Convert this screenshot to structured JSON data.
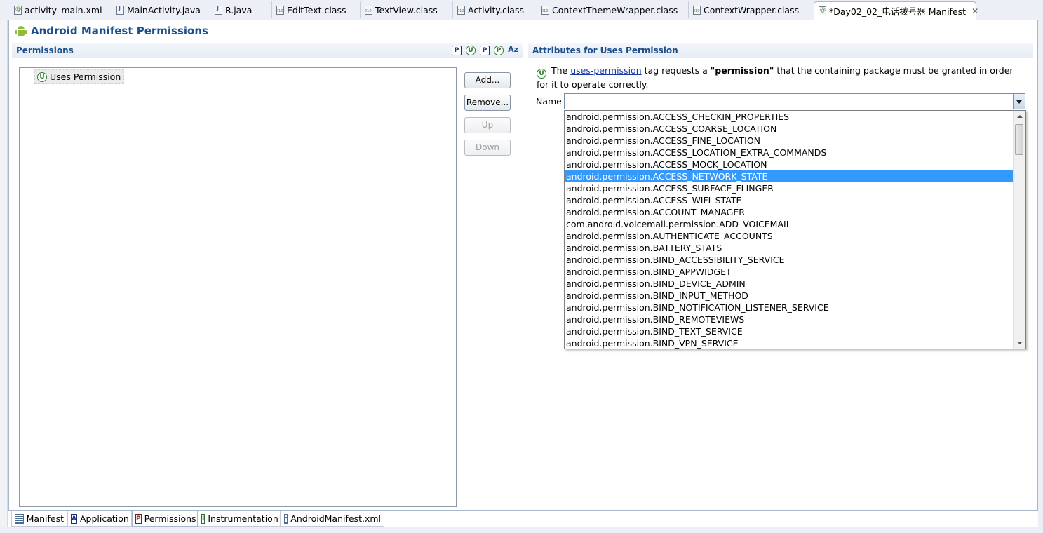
{
  "editor_tabs": [
    {
      "label": "activity_main.xml",
      "icon": "xml-file-icon"
    },
    {
      "label": "MainActivity.java",
      "icon": "java-file-icon"
    },
    {
      "label": "R.java",
      "icon": "java-file-icon"
    },
    {
      "label": "EditText.class",
      "icon": "class-file-icon"
    },
    {
      "label": "TextView.class",
      "icon": "class-file-icon"
    },
    {
      "label": "Activity.class",
      "icon": "class-file-icon"
    },
    {
      "label": "ContextThemeWrapper.class",
      "icon": "class-file-icon"
    },
    {
      "label": "ContextWrapper.class",
      "icon": "class-file-icon"
    },
    {
      "label": "*Day02_02_电话拨号器 Manifest",
      "icon": "manifest-file-icon",
      "active": true
    }
  ],
  "form": {
    "title": "Android Manifest Permissions"
  },
  "permissions_section": {
    "title": "Permissions",
    "toolbar": [
      "P",
      "U",
      "P",
      "P",
      "Az"
    ],
    "tree_items": [
      {
        "icon_letter": "U",
        "label": "Uses Permission"
      }
    ],
    "buttons": {
      "add": "Add...",
      "remove": "Remove...",
      "up": "Up",
      "down": "Down"
    }
  },
  "attributes_section": {
    "title": "Attributes for Uses Permission",
    "description": {
      "icon_letter": "U",
      "prefix": "The",
      "link": "uses-permission",
      "middle": "tag requests a",
      "bold": "\"permission\"",
      "suffix": "that the containing package must be granted in order for it to operate correctly."
    },
    "name_label": "Name",
    "name_value": "",
    "dropdown_options": [
      "android.permission.ACCESS_CHECKIN_PROPERTIES",
      "android.permission.ACCESS_COARSE_LOCATION",
      "android.permission.ACCESS_FINE_LOCATION",
      "android.permission.ACCESS_LOCATION_EXTRA_COMMANDS",
      "android.permission.ACCESS_MOCK_LOCATION",
      "android.permission.ACCESS_NETWORK_STATE",
      "android.permission.ACCESS_SURFACE_FLINGER",
      "android.permission.ACCESS_WIFI_STATE",
      "android.permission.ACCOUNT_MANAGER",
      "com.android.voicemail.permission.ADD_VOICEMAIL",
      "android.permission.AUTHENTICATE_ACCOUNTS",
      "android.permission.BATTERY_STATS",
      "android.permission.BIND_ACCESSIBILITY_SERVICE",
      "android.permission.BIND_APPWIDGET",
      "android.permission.BIND_DEVICE_ADMIN",
      "android.permission.BIND_INPUT_METHOD",
      "android.permission.BIND_NOTIFICATION_LISTENER_SERVICE",
      "android.permission.BIND_REMOTEVIEWS",
      "android.permission.BIND_TEXT_SERVICE",
      "android.permission.BIND_VPN_SERVICE"
    ],
    "selected_option": "android.permission.ACCESS_NETWORK_STATE"
  },
  "page_tabs": [
    {
      "label": "Manifest",
      "icon": "manifest-page-icon"
    },
    {
      "label": "Application",
      "icon_letter": "A"
    },
    {
      "label": "Permissions",
      "icon_letter": "P",
      "active": true
    },
    {
      "label": "Instrumentation",
      "icon_letter": "I"
    },
    {
      "label": "AndroidManifest.xml",
      "icon": "xml-source-icon"
    }
  ]
}
